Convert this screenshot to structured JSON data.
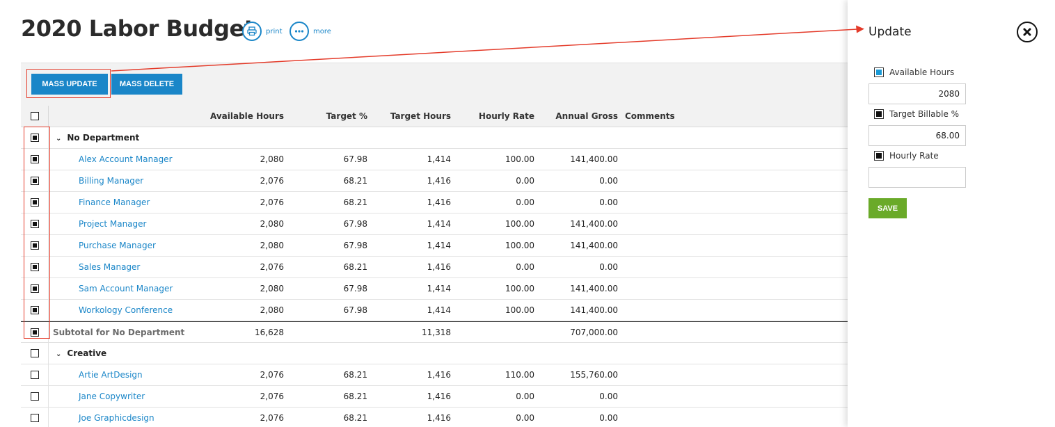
{
  "page": {
    "title": "2020 Labor Budget",
    "print_label": "print",
    "more_label": "more"
  },
  "toolbar": {
    "mass_update_label": "MASS UPDATE",
    "mass_delete_label": "MASS DELETE"
  },
  "table": {
    "columns": [
      "Available Hours",
      "Target %",
      "Target Hours",
      "Hourly Rate",
      "Annual Gross",
      "Comments"
    ],
    "groups": [
      {
        "name": "No Department",
        "checked": true,
        "rows": [
          {
            "name": "Alex Account Manager",
            "available_hours": "2,080",
            "target_pct": "67.98",
            "target_hours": "1,414",
            "hourly_rate": "100.00",
            "annual_gross": "141,400.00",
            "comments": ""
          },
          {
            "name": "Billing Manager",
            "available_hours": "2,076",
            "target_pct": "68.21",
            "target_hours": "1,416",
            "hourly_rate": "0.00",
            "annual_gross": "0.00",
            "comments": ""
          },
          {
            "name": "Finance Manager",
            "available_hours": "2,076",
            "target_pct": "68.21",
            "target_hours": "1,416",
            "hourly_rate": "0.00",
            "annual_gross": "0.00",
            "comments": ""
          },
          {
            "name": "Project Manager",
            "available_hours": "2,080",
            "target_pct": "67.98",
            "target_hours": "1,414",
            "hourly_rate": "100.00",
            "annual_gross": "141,400.00",
            "comments": ""
          },
          {
            "name": "Purchase Manager",
            "available_hours": "2,080",
            "target_pct": "67.98",
            "target_hours": "1,414",
            "hourly_rate": "100.00",
            "annual_gross": "141,400.00",
            "comments": ""
          },
          {
            "name": "Sales Manager",
            "available_hours": "2,076",
            "target_pct": "68.21",
            "target_hours": "1,416",
            "hourly_rate": "0.00",
            "annual_gross": "0.00",
            "comments": ""
          },
          {
            "name": "Sam Account Manager",
            "available_hours": "2,080",
            "target_pct": "67.98",
            "target_hours": "1,414",
            "hourly_rate": "100.00",
            "annual_gross": "141,400.00",
            "comments": ""
          },
          {
            "name": "Workology Conference",
            "available_hours": "2,080",
            "target_pct": "67.98",
            "target_hours": "1,414",
            "hourly_rate": "100.00",
            "annual_gross": "141,400.00",
            "comments": ""
          }
        ],
        "subtotal": {
          "label": "Subtotal for No Department",
          "available_hours": "16,628",
          "target_hours": "11,318",
          "annual_gross": "707,000.00",
          "checked": true
        }
      },
      {
        "name": "Creative",
        "checked": false,
        "rows": [
          {
            "name": "Artie ArtDesign",
            "available_hours": "2,076",
            "target_pct": "68.21",
            "target_hours": "1,416",
            "hourly_rate": "110.00",
            "annual_gross": "155,760.00",
            "comments": ""
          },
          {
            "name": "Jane Copywriter",
            "available_hours": "2,076",
            "target_pct": "68.21",
            "target_hours": "1,416",
            "hourly_rate": "0.00",
            "annual_gross": "0.00",
            "comments": ""
          },
          {
            "name": "Joe Graphicdesign",
            "available_hours": "2,076",
            "target_pct": "68.21",
            "target_hours": "1,416",
            "hourly_rate": "0.00",
            "annual_gross": "0.00",
            "comments": ""
          }
        ]
      }
    ]
  },
  "update_panel": {
    "title": "Update",
    "fields": [
      {
        "label": "Available Hours",
        "value": "2080",
        "checked": true,
        "check_color": "blue"
      },
      {
        "label": "Target Billable %",
        "value": "68.00",
        "checked": true,
        "check_color": "black"
      },
      {
        "label": "Hourly Rate",
        "value": "",
        "checked": true,
        "check_color": "black"
      }
    ],
    "save_label": "SAVE"
  },
  "colors": {
    "accent_blue": "#1a86c8",
    "save_green": "#6aaa29",
    "highlight_red": "#e43b2a"
  }
}
